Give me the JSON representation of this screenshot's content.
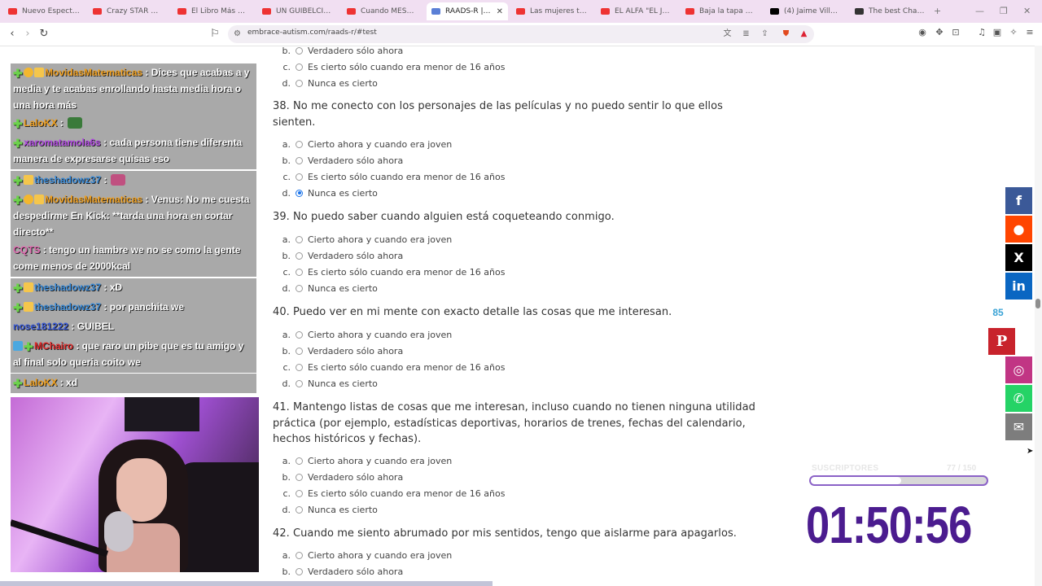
{
  "browser": {
    "tabs": [
      {
        "label": "Nuevo Espectro pol",
        "color": "#e33"
      },
      {
        "label": "Crazy STAR WARS f",
        "color": "#e33"
      },
      {
        "label": "El Libro Más Mister",
        "color": "#e33"
      },
      {
        "label": "UN GUIBELCITO ME",
        "color": "#e33"
      },
      {
        "label": "Cuando MESSI y SU",
        "color": "#e33"
      },
      {
        "label": "RAADS-R | Abr",
        "color": "#5b7fd6",
        "active": true
      },
      {
        "label": "Las mujeres tienen",
        "color": "#e33"
      },
      {
        "label": "EL ALFA \"EL JEFE\"",
        "color": "#e33"
      },
      {
        "label": "Baja la tapa del bañ",
        "color": "#e33"
      },
      {
        "label": "(4) Jaime Villalón",
        "color": "#000"
      },
      {
        "label": "The best ChatBot a",
        "color": "#333"
      }
    ],
    "new_tab": "+",
    "url": "embrace-autism.com/raads-r/#test"
  },
  "chat": [
    {
      "badges": [
        "plus",
        "gift",
        "crown"
      ],
      "user": "MovidasMatematicas",
      "user_color": "#f0a020",
      "text": ": Dices que acabas a y media y te acabas enrollando hasta media hora o una hora más"
    },
    {
      "badges": [
        "plus"
      ],
      "user": "LaloKX",
      "user_color": "#f0a020",
      "text": ":",
      "emote": "#3a7a3a"
    },
    {
      "badges": [
        "plus"
      ],
      "user": "xaromatamola6s",
      "user_color": "#b04ae0",
      "text": ": cada persona tiene diferenta manera de expresarse quisas eso"
    },
    {
      "badges": [
        "plus",
        "crown"
      ],
      "user": "theshadowz37",
      "user_color": "#3a8ad6",
      "text": ":",
      "emote": "#c05080"
    },
    {
      "badges": [
        "plus",
        "gift",
        "crown"
      ],
      "user": "MovidasMatematicas",
      "user_color": "#f0a020",
      "text": ": Venus: No me cuesta despedirme En Kick: **tarda una hora en cortar directo**"
    },
    {
      "badges": [],
      "user": "CQTS",
      "user_color": "#e06ab0",
      "text": ": tengo un hambre we no se como la gente come menos de 2000kcal"
    },
    {
      "badges": [
        "plus",
        "crown"
      ],
      "user": "theshadowz37",
      "user_color": "#3a8ad6",
      "text": ": xD"
    },
    {
      "badges": [
        "plus",
        "crown"
      ],
      "user": "theshadowz37",
      "user_color": "#3a8ad6",
      "text": ": por panchita we"
    },
    {
      "badges": [],
      "user": "nose181222",
      "user_color": "#3a5ad6",
      "text": ": GUIBEL"
    },
    {
      "badges": [
        "mod",
        "plus"
      ],
      "user": "MChairo",
      "user_color": "#e02a2a",
      "text": ": que raro un pibe que es tu amigo y al final solo queria coito we"
    },
    {
      "badges": [
        "plus"
      ],
      "user": "LaloKX",
      "user_color": "#f0a020",
      "text": ": xd"
    }
  ],
  "quiz": {
    "top_options": [
      {
        "letter": "b.",
        "label": "Verdadero sólo ahora",
        "checked": false
      },
      {
        "letter": "c.",
        "label": "Es cierto sólo cuando era menor de 16 años",
        "checked": false
      },
      {
        "letter": "d.",
        "label": "Nunca es cierto",
        "checked": false
      }
    ],
    "questions": [
      {
        "title": "38. No me conecto con los personajes de las películas y no puedo sentir lo que ellos sienten.",
        "checked": 3
      },
      {
        "title": "39. No puedo saber cuando alguien está coqueteando conmigo.",
        "checked": -1
      },
      {
        "title": "40. Puedo ver en mi mente con exacto detalle las cosas que me interesan.",
        "checked": -1
      },
      {
        "title": "41. Mantengo listas de cosas que me interesan, incluso cuando no tienen ninguna utilidad práctica (por ejemplo, estadísticas deportivas, horarios de trenes, fechas del calendario, hechos históricos y fechas).",
        "checked": -1
      },
      {
        "title": "42. Cuando me siento abrumado por mis sentidos, tengo que aislarme para apagarlos.",
        "checked": -1
      }
    ],
    "options": [
      {
        "letter": "a.",
        "label": "Cierto ahora y cuando era joven"
      },
      {
        "letter": "b.",
        "label": "Verdadero sólo ahora"
      },
      {
        "letter": "c.",
        "label": "Es cierto sólo cuando era menor de 16 años"
      },
      {
        "letter": "d.",
        "label": "Nunca es cierto"
      }
    ]
  },
  "share": {
    "count": "85",
    "buttons": [
      {
        "name": "facebook",
        "glyph": "f",
        "color": "#3b5998"
      },
      {
        "name": "reddit",
        "glyph": "●",
        "color": "#ff4500"
      },
      {
        "name": "x",
        "glyph": "X",
        "color": "#000000"
      },
      {
        "name": "linkedin",
        "glyph": "in",
        "color": "#0a66c2"
      },
      {
        "name": "instagram",
        "glyph": "◎",
        "color": "#c13584"
      },
      {
        "name": "whatsapp",
        "glyph": "✆",
        "color": "#25d366"
      },
      {
        "name": "email",
        "glyph": "✉",
        "color": "#7d7d7d"
      }
    ],
    "pinterest_glyph": "P"
  },
  "stream_widget": {
    "subs_label": "SUSCRIPTORES",
    "subs_count": "77 / 150",
    "subs_progress": 0.513,
    "timer": "01:50:56"
  }
}
